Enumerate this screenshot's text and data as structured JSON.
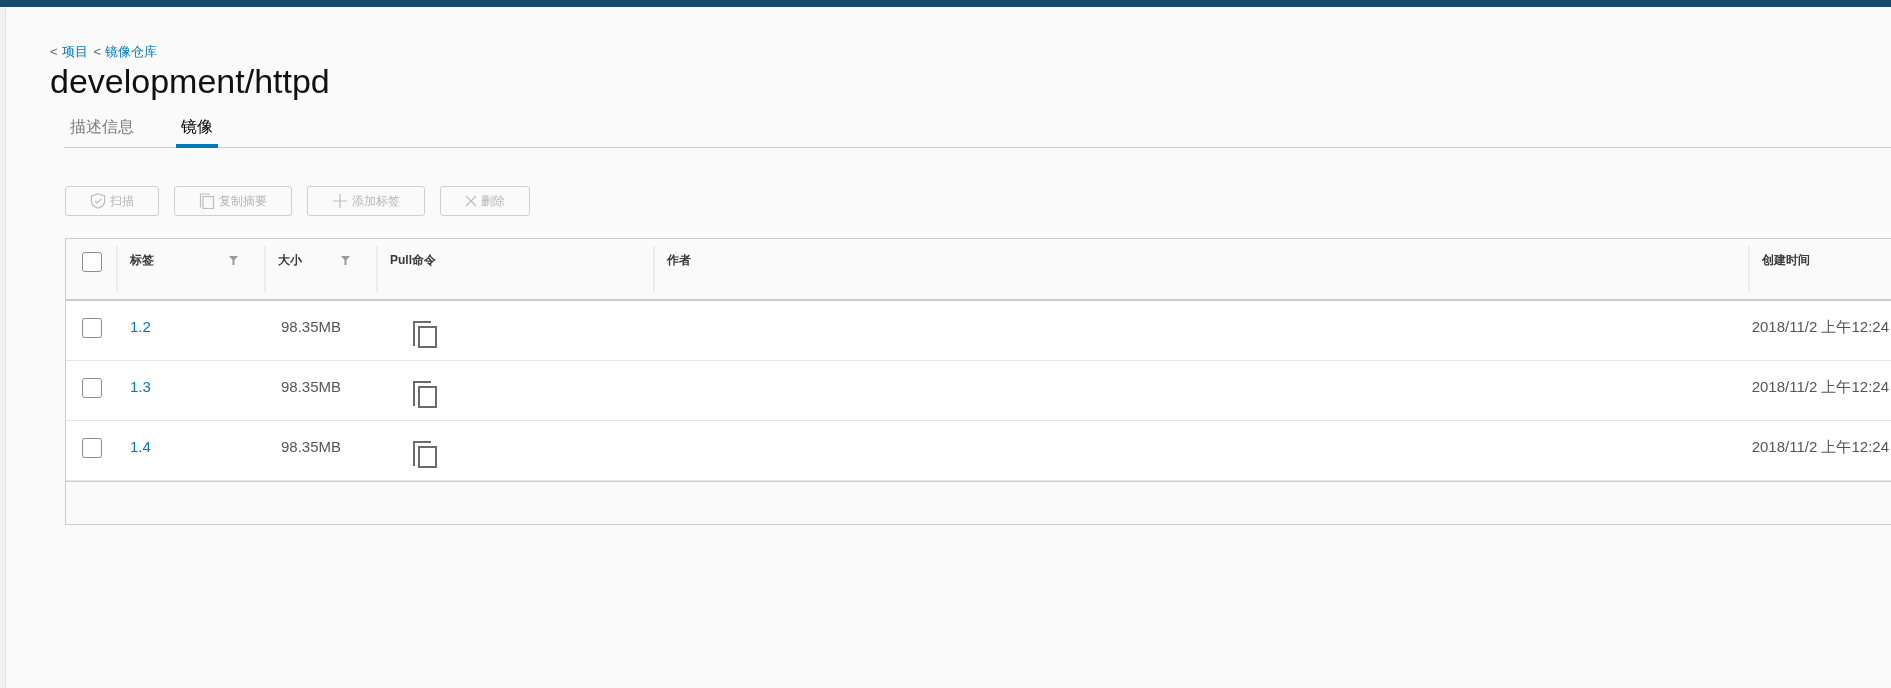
{
  "breadcrumb": [
    {
      "separator": "<",
      "label": "项目"
    },
    {
      "separator": "<",
      "label": "镜像仓库"
    }
  ],
  "title": "development/httpd",
  "tabs": [
    {
      "label": "描述信息",
      "selected": false
    },
    {
      "label": "镜像",
      "selected": true
    }
  ],
  "toolbar": [
    {
      "kind": "scan",
      "label": "扫描",
      "disabled": true
    },
    {
      "kind": "copy",
      "label": "复制摘要",
      "disabled": true
    },
    {
      "kind": "add",
      "label": "添加标签",
      "disabled": true
    },
    {
      "kind": "delete",
      "label": "删除",
      "disabled": true
    }
  ],
  "table": {
    "select_all": {
      "checked": false
    },
    "columns": [
      {
        "label": "标签",
        "filter": true
      },
      {
        "label": "大小",
        "filter": true
      },
      {
        "label": "Pull命令",
        "filter": false
      },
      {
        "label": "作者",
        "filter": false
      },
      {
        "label": "创建时间",
        "filter": false
      }
    ],
    "rows": [
      {
        "checked": false,
        "tag": "1.2",
        "size": "98.35MB",
        "created": "2018/11/2 上午12:24"
      },
      {
        "checked": false,
        "tag": "1.3",
        "size": "98.35MB",
        "created": "2018/11/2 上午12:24"
      },
      {
        "checked": false,
        "tag": "1.4",
        "size": "98.35MB",
        "created": "2018/11/2 上午12:24"
      }
    ]
  }
}
